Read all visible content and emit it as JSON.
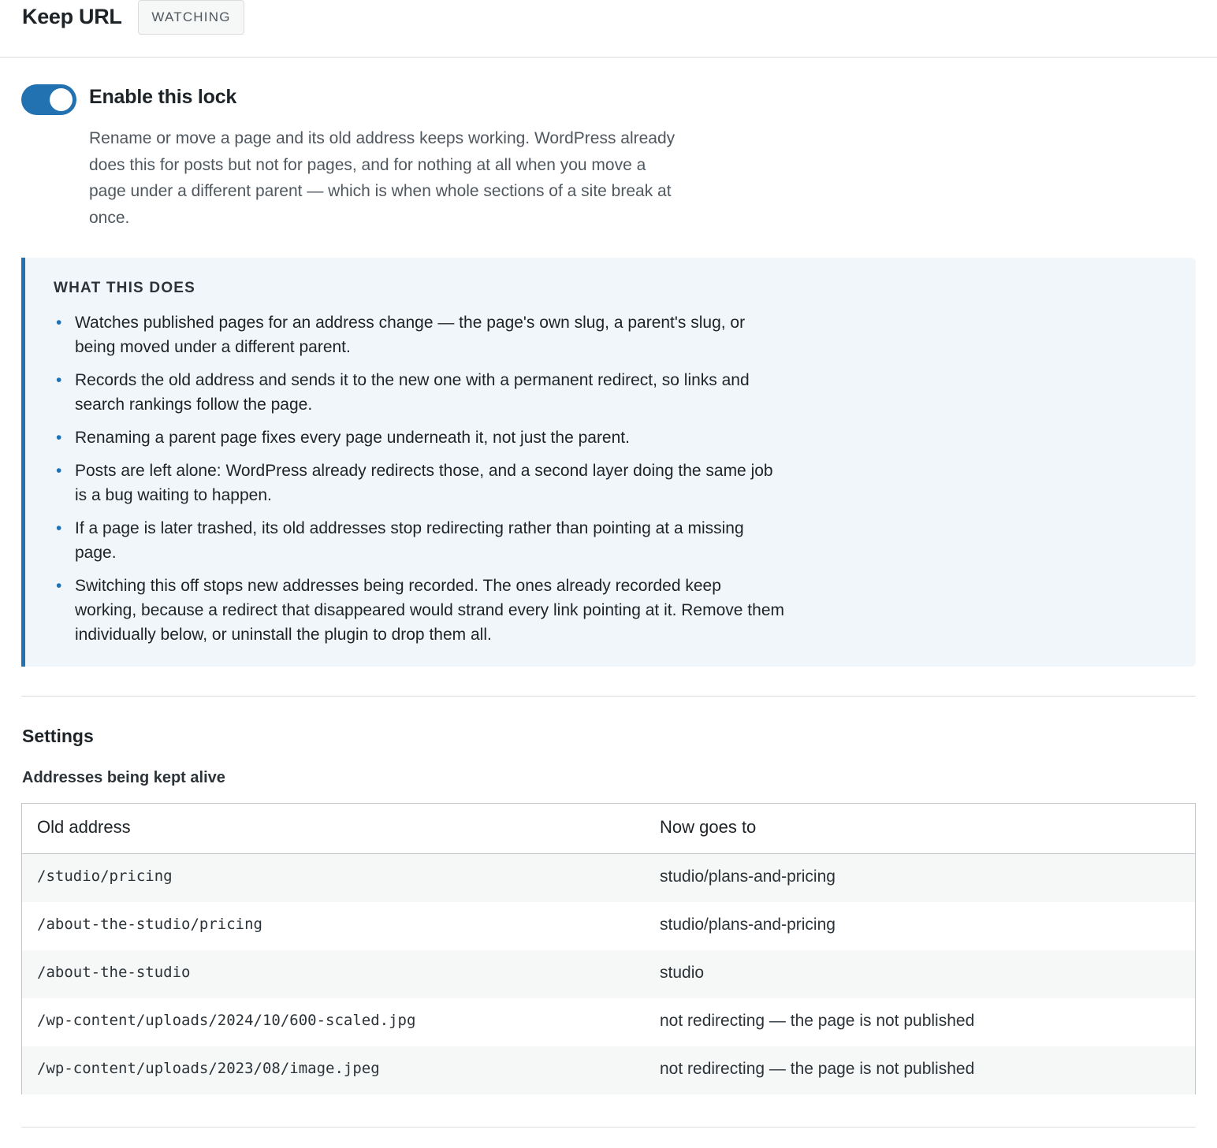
{
  "header": {
    "title": "Keep URL",
    "status_badge": "WATCHING"
  },
  "lock": {
    "toggle_state": "on",
    "label": "Enable this lock",
    "description": "Rename or move a page and its old address keeps working. WordPress already does this for posts but not for pages, and for nothing at all when you move a page under a different parent — which is when whole sections of a site break at once."
  },
  "info": {
    "heading": "WHAT THIS DOES",
    "bullet": "•",
    "items": [
      "Watches published pages for an address change — the page's own slug, a parent's slug, or being moved under a different parent.",
      "Records the old address and sends it to the new one with a permanent redirect, so links and search rankings follow the page.",
      "Renaming a parent page fixes every page underneath it, not just the parent.",
      "Posts are left alone: WordPress already redirects those, and a second layer doing the same job is a bug waiting to happen.",
      "If a page is later trashed, its old addresses stop redirecting rather than pointing at a missing page.",
      "Switching this off stops new addresses being recorded. The ones already recorded keep working, because a redirect that disappeared would strand every link pointing at it. Remove them individually below, or uninstall the plugin to drop them all."
    ]
  },
  "settings": {
    "heading": "Settings",
    "table_heading": "Addresses being kept alive",
    "columns": [
      "Old address",
      "Now goes to"
    ],
    "rows": [
      {
        "old": "/studio/pricing",
        "new": "studio/plans-and-pricing"
      },
      {
        "old": "/about-the-studio/pricing",
        "new": "studio/plans-and-pricing"
      },
      {
        "old": "/about-the-studio",
        "new": "studio"
      },
      {
        "old": "/wp-content/uploads/2024/10/600-scaled.jpg",
        "new": "not redirecting — the page is not published"
      },
      {
        "old": "/wp-content/uploads/2023/08/image.jpeg",
        "new": "not redirecting — the page is not published"
      }
    ]
  },
  "colors": {
    "accent": "#2271b1",
    "info_background": "#f0f6fa",
    "border": "#dcdcde"
  }
}
